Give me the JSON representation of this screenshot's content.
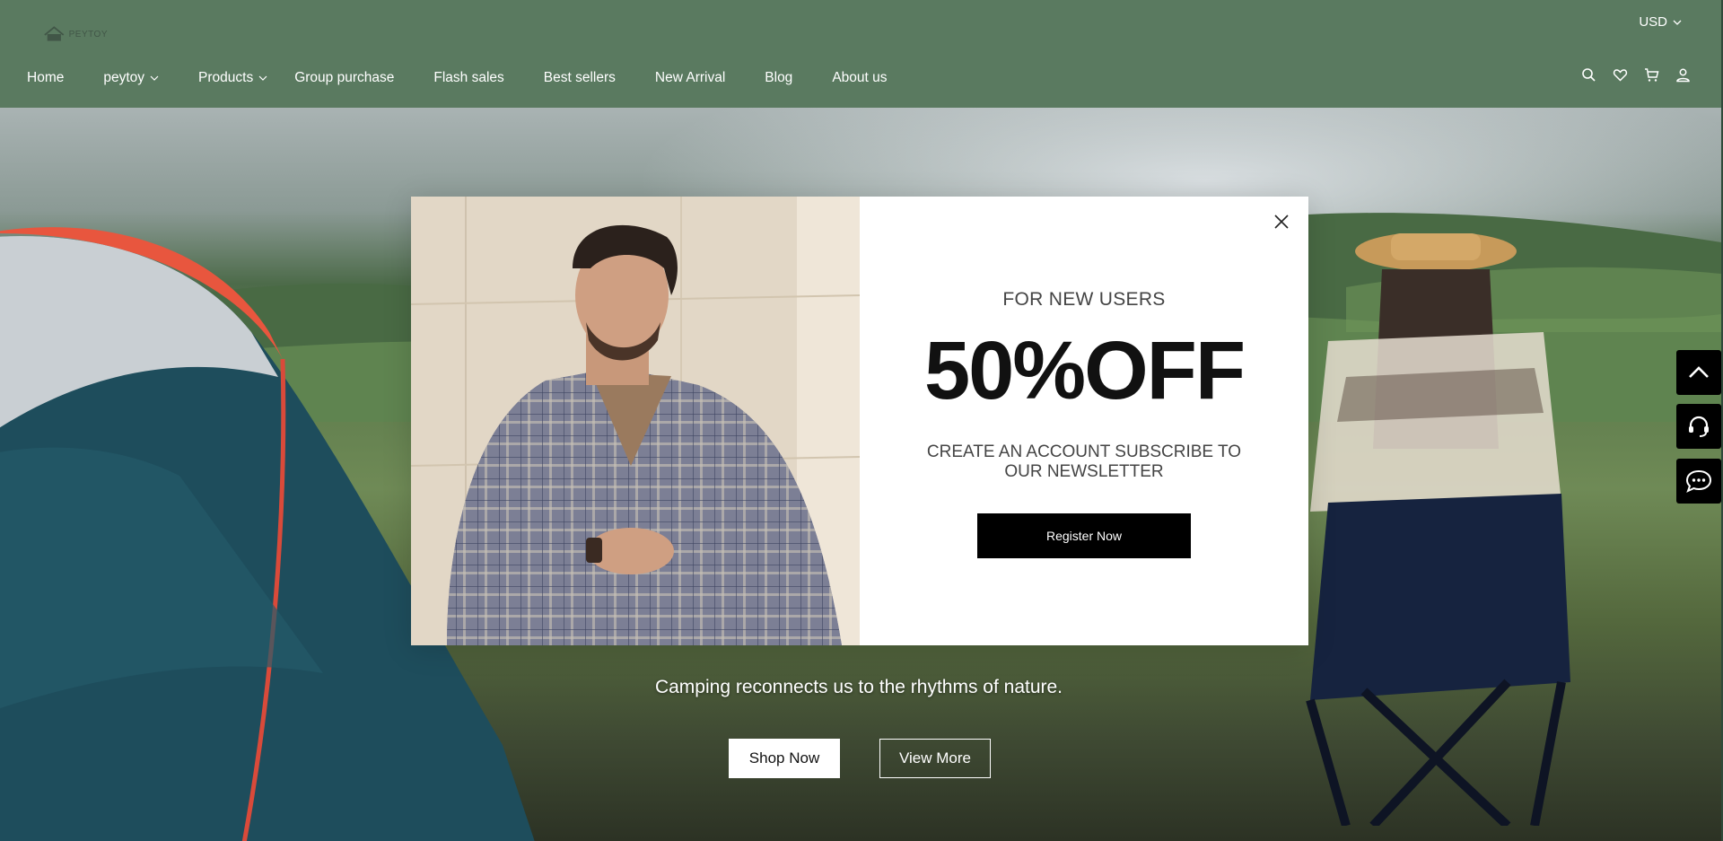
{
  "header": {
    "logo_text": "PEYTOY",
    "currency": "USD",
    "nav": [
      {
        "label": "Home"
      },
      {
        "label": "peytoy"
      },
      {
        "label": "Products"
      },
      {
        "label": "Group purchase"
      },
      {
        "label": "Flash sales"
      },
      {
        "label": "Best sellers"
      },
      {
        "label": "New Arrival"
      },
      {
        "label": "Blog"
      },
      {
        "label": "About us"
      }
    ],
    "icons": [
      "search-icon",
      "heart-icon",
      "cart-icon",
      "user-icon"
    ]
  },
  "hero": {
    "tagline": "Camping reconnects us to the rhythms of nature.",
    "shop_now": "Shop Now",
    "view_more": "View More"
  },
  "modal": {
    "eyebrow": "FOR NEW USERS",
    "headline": "50%OFF",
    "description": "CREATE AN ACCOUNT SUBSCRIBE TO OUR NEWSLETTER",
    "cta": "Register Now"
  },
  "floating": [
    "back-to-top-icon",
    "support-headset-icon",
    "chat-bubble-icon"
  ],
  "colors": {
    "header_bg": "#5a7a60",
    "cta_bg": "#000000",
    "widget_bg": "#000000"
  }
}
